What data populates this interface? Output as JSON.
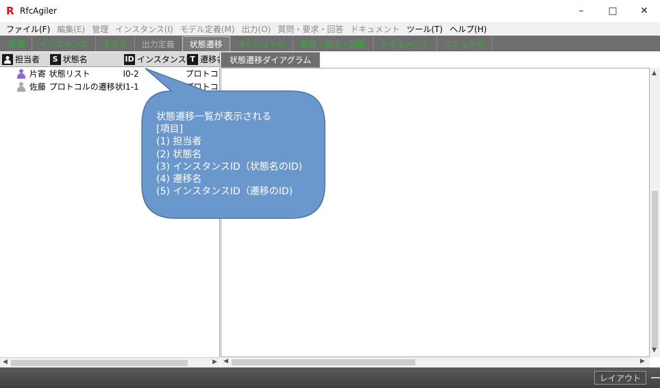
{
  "window": {
    "title": "RfcAgiler",
    "logo": "R"
  },
  "menu": [
    {
      "label": "ファイル(F)",
      "disabled": false
    },
    {
      "label": "編集(E)",
      "disabled": true
    },
    {
      "label": "管理",
      "disabled": true
    },
    {
      "label": "インスタンス(I)",
      "disabled": true
    },
    {
      "label": "モデル定義(M)",
      "disabled": true
    },
    {
      "label": "出力(O)",
      "disabled": true
    },
    {
      "label": "質問・要求・回答",
      "disabled": true
    },
    {
      "label": "ドキュメント",
      "disabled": true
    },
    {
      "label": "ツール(T)",
      "disabled": false
    },
    {
      "label": "ヘルプ(H)",
      "disabled": false
    }
  ],
  "tabs": [
    {
      "label": "管理",
      "style": "green"
    },
    {
      "label": "インスタンス",
      "style": "green"
    },
    {
      "label": "モデル",
      "style": "green"
    },
    {
      "label": "出力定義",
      "style": "gray"
    },
    {
      "label": "状態遷移",
      "style": "active"
    },
    {
      "label": "スケジュール",
      "style": "green"
    },
    {
      "label": "質問・要求・回答",
      "style": "green"
    },
    {
      "label": "ドキュメント",
      "style": "green"
    },
    {
      "label": "マニュアル",
      "style": "green"
    }
  ],
  "columns": {
    "assignee": {
      "badge": "person-icon",
      "label": "担当者"
    },
    "state_name": {
      "badge": "S",
      "label": "状態名"
    },
    "instance_id": {
      "badge": "ID",
      "label": "インスタンスID"
    },
    "transition_name": {
      "badge": "T",
      "label": "遷移名"
    }
  },
  "rows": [
    {
      "assignee": "片寄",
      "state_name": "状態リスト",
      "instance_id": "I0-2",
      "transition_name": "プロトコル",
      "icon_color": "#8a6ad0"
    },
    {
      "assignee": "佐藤",
      "state_name": "プロトコルの遷移状態",
      "instance_id": "I1-1",
      "transition_name": "プロトコル",
      "icon_color": "#a8a8a8"
    }
  ],
  "right_tab": {
    "label": "状態遷移ダイアグラム"
  },
  "callout": {
    "text": "状態遷移一覧が表示される\n[項目]\n(1) 担当者\n(2) 状態名\n(3) インスタンスID（状態名のID)\n(4) 遷移名\n(5) インスタンスID（遷移のID)",
    "fill": "#6a97cc"
  },
  "status": {
    "layout_button": "レイアウト"
  }
}
